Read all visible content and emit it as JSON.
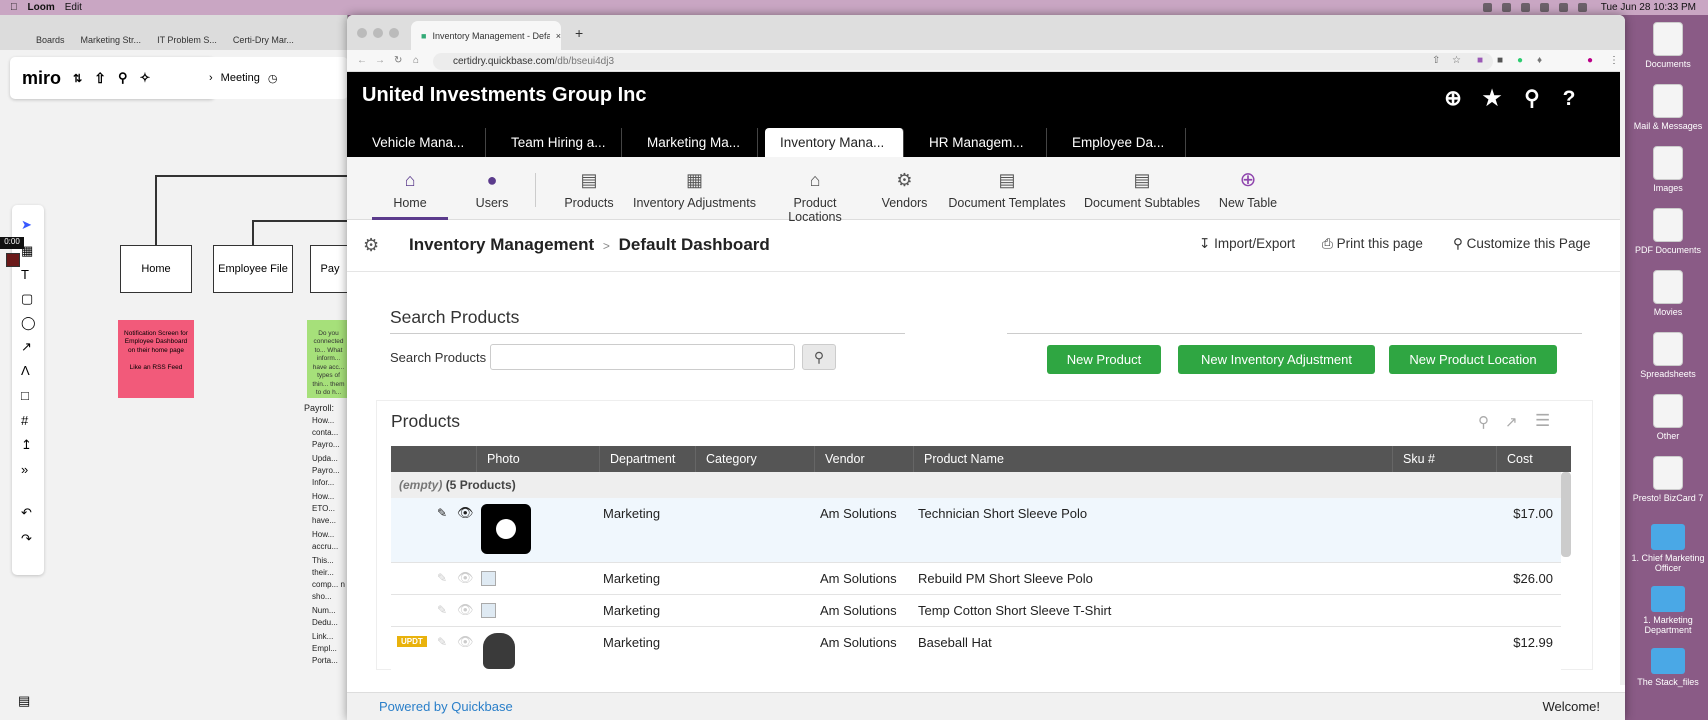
{
  "menubar": {
    "app": "Loom",
    "edit": "Edit",
    "clock": "Tue Jun 28  10:33 PM"
  },
  "miro": {
    "tabs": [
      "Boards",
      "Marketing Str...",
      "IT Problem S...",
      "Certi-Dry Mar..."
    ],
    "window_title": "Miro",
    "logo": "miro",
    "meeting": "Meeting",
    "boxes": [
      "Home",
      "Employee File",
      "Pay"
    ],
    "sticky_pink": "Notification Screen for Employee Dashboard on their home page\n\nLike an RSS Feed",
    "sticky_green": "Do you connected to... What inform... have acc... types of thin... them to do h...",
    "payroll_title": "Payroll:",
    "payroll_items": [
      "How... conta... Payro...",
      "Upda... Payro... Infor...",
      "How... ETO... have...",
      "How... accru...",
      "This... their... comp... n sho...",
      "Num... Dedu...",
      "Link... Empl... Porta..."
    ],
    "timer": "0:00"
  },
  "desktop": {
    "icons": [
      "Documents",
      "Mail & Messages",
      "Images",
      "PDF Documents",
      "Movies",
      "Spreadsheets",
      "Other",
      "Presto! BizCard 7",
      "1. Chief Marketing Officer",
      "1. Marketing Department",
      "The Stack_files"
    ]
  },
  "browser": {
    "tab_title": "Inventory Management - Defa...",
    "url_domain": "certidry.quickbase.com",
    "url_path": "/db/bseui4dj3"
  },
  "quickbase": {
    "company": "United Investments Group Inc",
    "app_tabs": [
      "Vehicle Mana...",
      "Team Hiring a...",
      "Marketing Ma...",
      "Inventory Mana...",
      "HR Managem...",
      "Employee Da..."
    ],
    "active_app_tab": 3,
    "table_nav": [
      {
        "label": "Home",
        "icon": "home-icon"
      },
      {
        "label": "Users",
        "icon": "users-icon"
      },
      {
        "label": "Products",
        "icon": "barcode-icon"
      },
      {
        "label": "Inventory Adjustments",
        "icon": "adjustments-icon"
      },
      {
        "label": "Product Locations",
        "icon": "warehouse-icon"
      },
      {
        "label": "Vendors",
        "icon": "vendors-icon"
      },
      {
        "label": "Document Templates",
        "icon": "document-icon"
      },
      {
        "label": "Document Subtables",
        "icon": "subtable-icon"
      },
      {
        "label": "New Table",
        "icon": "plus-circle-icon"
      }
    ],
    "breadcrumb": {
      "app": "Inventory Management",
      "separator": ">",
      "page": "Default Dashboard"
    },
    "page_actions": [
      "Import/Export",
      "Print this page",
      "Customize this Page"
    ],
    "search": {
      "heading": "Search Products",
      "label": "Search Products",
      "placeholder": ""
    },
    "buttons": [
      "New Product",
      "New Inventory Adjustment",
      "New Product Location"
    ],
    "products": {
      "heading": "Products",
      "columns": [
        "Photo",
        "Department",
        "Category",
        "Vendor",
        "Product Name",
        "Sku #",
        "Cost"
      ],
      "group_empty": "(empty)",
      "group_count": "(5 Products)",
      "rows": [
        {
          "department": "Marketing",
          "vendor": "Am Solutions",
          "name": "Technician Short Sleeve Polo",
          "cost": "$17.00",
          "badge": ""
        },
        {
          "department": "Marketing",
          "vendor": "Am Solutions",
          "name": "Rebuild PM Short Sleeve Polo",
          "cost": "$26.00",
          "badge": ""
        },
        {
          "department": "Marketing",
          "vendor": "Am Solutions",
          "name": "Temp Cotton Short Sleeve T-Shirt",
          "cost": "",
          "badge": ""
        },
        {
          "department": "Marketing",
          "vendor": "Am Solutions",
          "name": "Baseball Hat",
          "cost": "$12.99",
          "badge": "UPDT"
        }
      ]
    },
    "footer": {
      "powered": "Powered by Quickbase",
      "welcome": "Welcome!"
    }
  }
}
